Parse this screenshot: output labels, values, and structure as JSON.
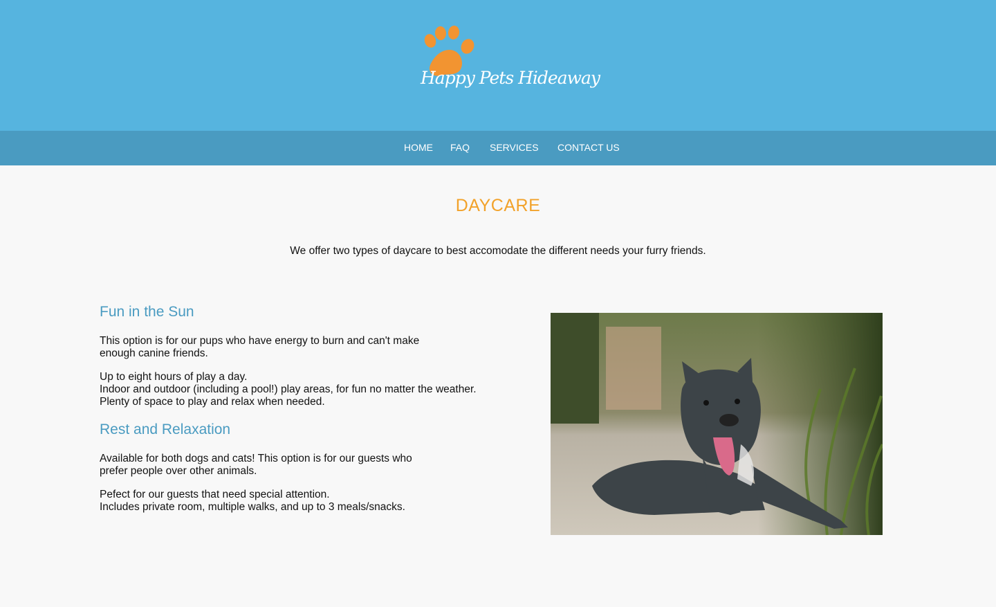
{
  "brand": {
    "name": "Happy Pets Hideaway",
    "colors": {
      "header": "#56b4df",
      "nav": "#4a9bc1",
      "accent": "#f2a22a",
      "paw": "#f29431"
    }
  },
  "nav": {
    "items": [
      "HOME",
      "FAQ",
      "SERVICES",
      "CONTACT US"
    ]
  },
  "page": {
    "title": "DAYCARE",
    "intro": "We offer two types of daycare to best accomodate the different needs your furry friends."
  },
  "sections": [
    {
      "heading": "Fun in the Sun",
      "p1_line1": "This option is for our pups who have energy to burn and can't make",
      "p1_line2": "enough canine friends.",
      "p2_line1": "Up to eight hours of play a day.",
      "p2_line2": "Indoor and outdoor (including a pool!) play areas, for fun no matter the weather.",
      "p2_line3": "Plenty of space to play and relax when needed."
    },
    {
      "heading": "Rest and Relaxation",
      "p1_line1": "Available for both dogs and cats! This option is for our guests who",
      "p1_line2": "prefer people over other animals.",
      "p2_line1": "Pefect for our guests that need special attention.",
      "p2_line2": "Includes private room, multiple walks, and up to 3 meals/snacks."
    }
  ],
  "photo": {
    "icon": "dog-photo"
  }
}
